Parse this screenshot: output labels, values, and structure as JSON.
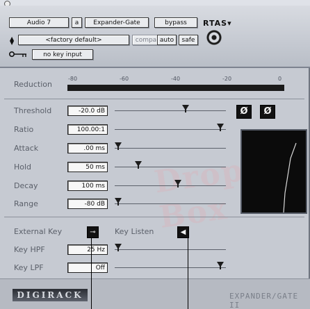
{
  "header": {
    "track_name": "Audio 7",
    "insert_slot": "a",
    "plugin_name": "Expander-Gate",
    "bypass_label": "bypass",
    "format_label": "RTAS",
    "format_arrow": "▾",
    "preset_name": "<factory default>",
    "compare_label": "compare",
    "auto_label": "auto",
    "safe_label": "safe",
    "key_input_label": "no key input",
    "knob_icon": "target-icon",
    "key_icon": "key-icon"
  },
  "reduction": {
    "label": "Reduction",
    "scale": [
      "-80",
      "-60",
      "-40",
      "-20",
      "0"
    ]
  },
  "controls": [
    {
      "label": "Threshold",
      "value": "-20.0 dB",
      "level": 0.64
    },
    {
      "label": "Ratio",
      "value": "100.00:1",
      "level": 0.95
    },
    {
      "label": "Attack",
      "value": ".00 ms",
      "level": 0.03
    },
    {
      "label": "Hold",
      "value": "50 ms",
      "level": 0.21
    },
    {
      "label": "Decay",
      "value": "100 ms",
      "level": 0.57
    },
    {
      "label": "Range",
      "value": "-80 dB",
      "level": 0.03
    }
  ],
  "phase_buttons": [
    "Ø",
    "Ø"
  ],
  "sidechain": {
    "external_key_label": "External Key",
    "key_listen_label": "Key Listen",
    "external_key_icon": "key-on-icon",
    "key_listen_icon": "speaker-icon",
    "key_hpf_label": "Key HPF",
    "key_hpf_value": "25 Hz",
    "key_hpf_level": 0.03,
    "key_lpf_label": "Key LPF",
    "key_lpf_value": "Off",
    "key_lpf_level": 0.95
  },
  "footer": {
    "logo_text": "DIGIRACK",
    "brand_text": "EXPANDER/GATE II"
  },
  "watermark_text": "Drop Box"
}
